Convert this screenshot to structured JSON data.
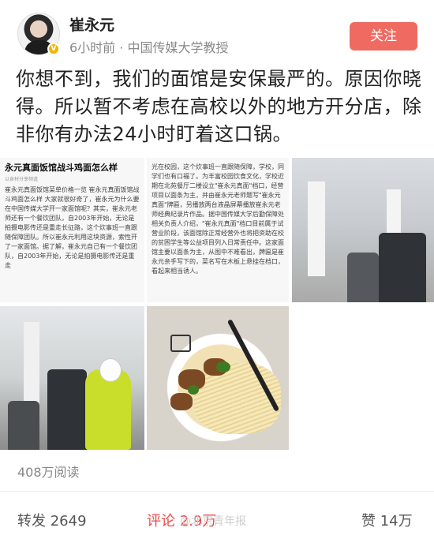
{
  "user": {
    "name": "崔永元",
    "meta": "6小时前 · 中国传媒大学教授",
    "follow_label": "关注"
  },
  "post": {
    "text": "你想不到，我们的面馆是安保最严的。原因你晓得。所以暂不考虑在高校以外的地方开分店，除非你有办法24小时盯着这口锅。"
  },
  "images": {
    "doc1": {
      "title": "永元真面饭馆战斗鸡面怎么样",
      "subtitle": "以食材分享频道",
      "body": "崔永元真面饭馆菜单价格一览 崔永元真面饭馆战斗鸡面怎么样 大家就很好奇了，崔永元为什么要在中国传媒大学开一家面馆呢？其实，崔永元老师还有一个餐饮团队，自2003年开始，无论是拍摄电影传还是重走长征路，这个炊事班一直跟随保障团队。所以崔永元利用这块资源，索性开了一家面馆。据了解，崔永元自己有一个餐饮团队，自2003年开始，无论是拍摄电影传还是重走"
    },
    "doc2": {
      "body": "光在校园，这个炊事班一直跟随保障，学校，同学们也有口福了。为丰富校园饮食文化，学校近期在北苑餐厅二楼设立\"崔永元真面\"档口，经营项目以面条为主，并由崔永元老师题写\"崔永元真面\"牌匾，另播放两台液晶屏幕播放崔永元老师经典纪录片作品。据中国传媒大学后勤保障处相关负责人介绍，\"崔永元真面\"档口目前属于试营业阶段，该面馆除正常经营外也将把资助在校的贫困学生等公益项目列入日常责任中。这家面馆主要以面条为主，从图中不难看出，牌匾是崔永元亲手写下的，菜名写在木板上悬挂在档口，看起来相当诱人。"
    }
  },
  "stats": {
    "reads": "408万阅读"
  },
  "actions": {
    "repost": "转发 2649",
    "comment": "评论 2.9万",
    "like": "赞 14万"
  },
  "watermark": "@北京青年报"
}
